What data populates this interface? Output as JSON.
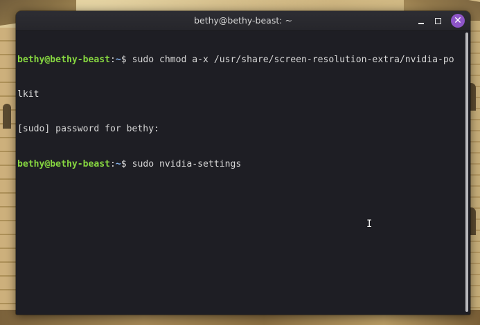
{
  "window": {
    "title": "bethy@bethy-beast: ~"
  },
  "controls": {
    "minimize_icon": "minimize-icon",
    "maximize_icon": "maximize-icon",
    "close_icon": "close-icon",
    "close_glyph": "✕",
    "close_color": "#8e55c9"
  },
  "terminal": {
    "lines": [
      {
        "user": "bethy@bethy-beast",
        "sep": ":",
        "path": "~",
        "sign": "$ ",
        "command": "sudo chmod a-x /usr/share/screen-resolution-extra/nvidia-po"
      },
      {
        "text": "lkit"
      },
      {
        "text": "[sudo] password for bethy:"
      },
      {
        "user": "bethy@bethy-beast",
        "sep": ":",
        "path": "~",
        "sign": "$ ",
        "command": "sudo nvidia-settings"
      }
    ],
    "prompt_user_color": "#86d640",
    "prompt_path_color": "#86b4ef",
    "background": "#1e1e24"
  },
  "cursor": {
    "glyph": "I",
    "icon": "text-cursor-icon"
  }
}
